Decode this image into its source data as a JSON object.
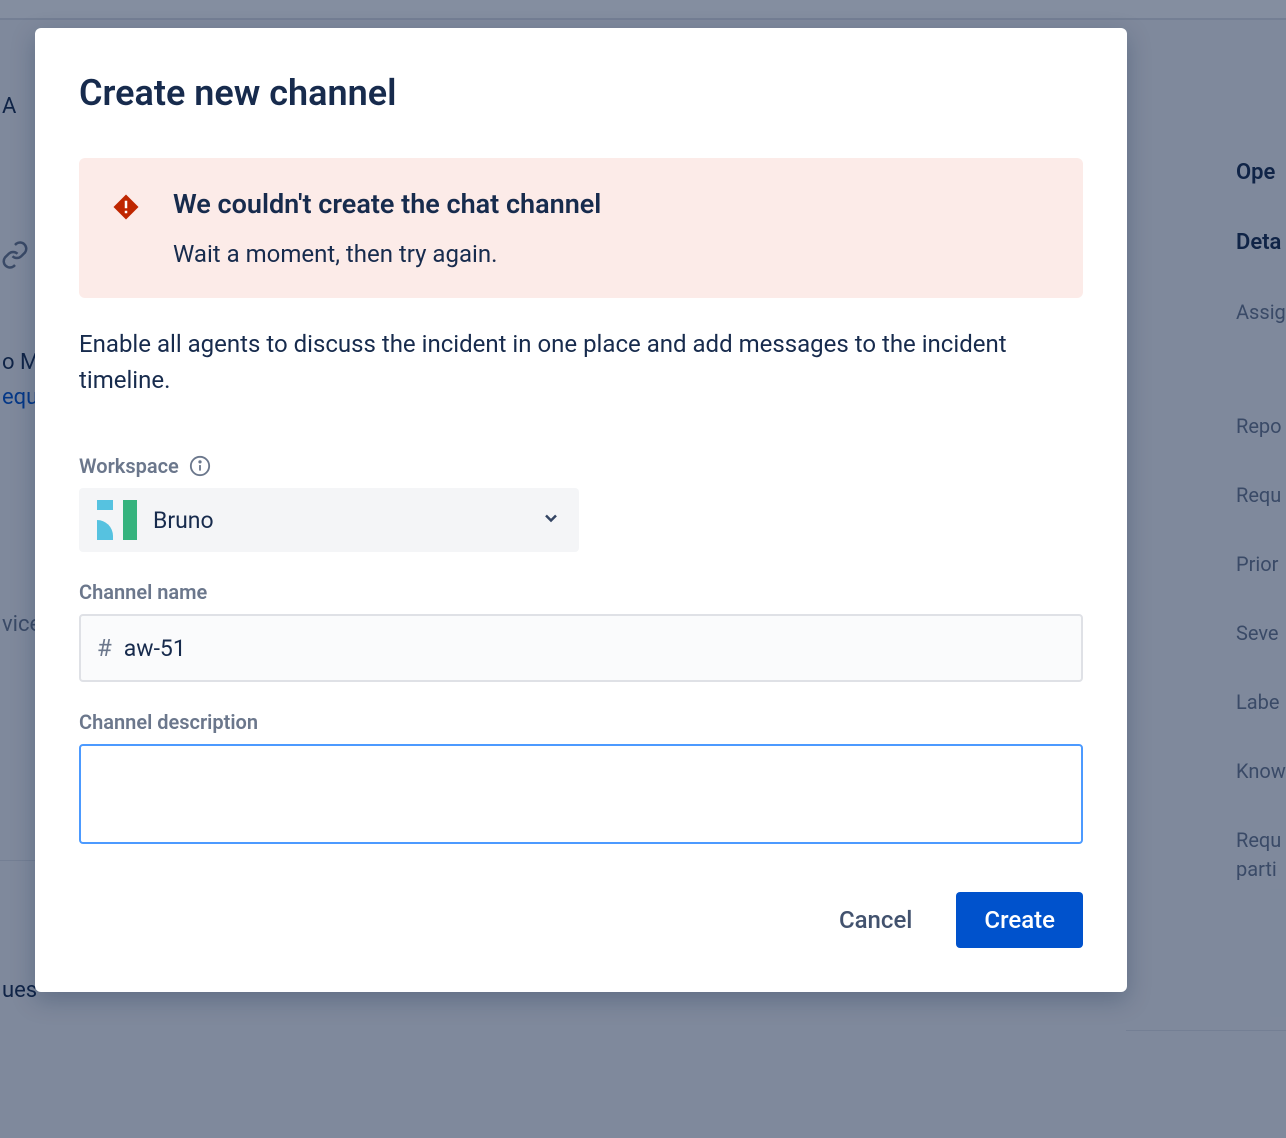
{
  "modal": {
    "title": "Create new channel",
    "error": {
      "title": "We couldn't create the chat channel",
      "body": "Wait a moment, then try again."
    },
    "description": "Enable all agents to discuss the incident in one place and add messages to the incident timeline.",
    "workspace": {
      "label": "Workspace",
      "selected": "Bruno"
    },
    "channel_name": {
      "label": "Channel name",
      "prefix": "#",
      "value": "aw-51"
    },
    "channel_description": {
      "label": "Channel description",
      "value": ""
    },
    "buttons": {
      "cancel": "Cancel",
      "create": "Create"
    }
  },
  "background": {
    "left": [
      "A",
      "o M",
      "equ",
      "vice",
      "ues"
    ],
    "right": [
      "Ope",
      "Deta",
      "Assig",
      "Repo",
      "Requ",
      "Prior",
      "Seve",
      "Labe",
      "Know",
      "Requ",
      "parti"
    ]
  }
}
